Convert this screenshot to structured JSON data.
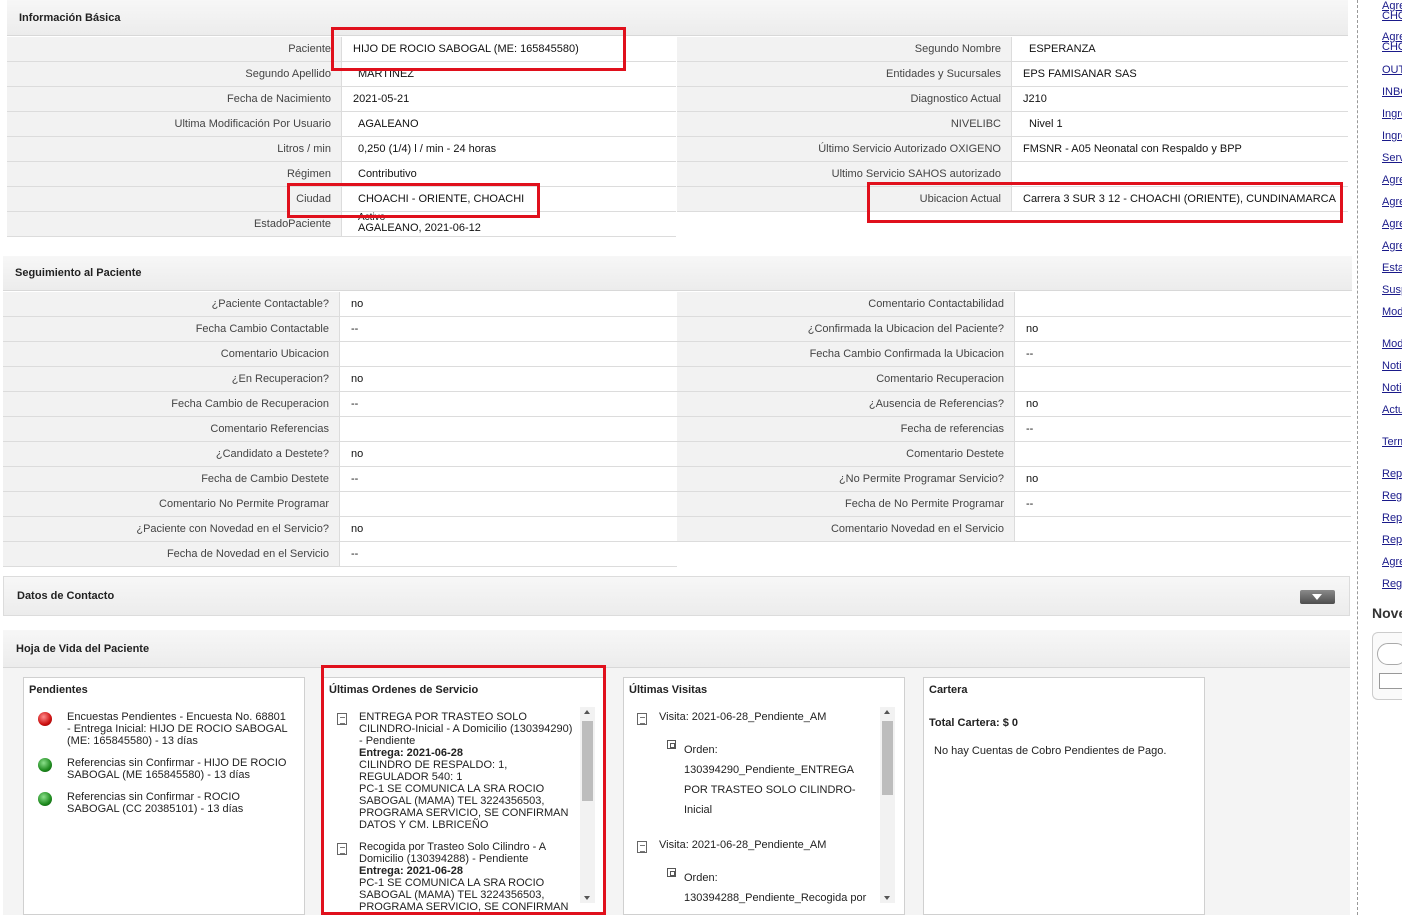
{
  "basic_info": {
    "title": "Información Básica",
    "left_rows": [
      {
        "label": "Paciente",
        "value": "HIJO DE ROCIO SABOGAL (ME: 165845580)"
      },
      {
        "label": "Segundo Apellido",
        "value": "MARTINEZ"
      },
      {
        "label": "Fecha de Nacimiento",
        "value": "2021-05-21"
      },
      {
        "label": "Ultima Modificación Por Usuario",
        "value": "AGALEANO"
      },
      {
        "label": "Litros / min",
        "value": "0,250 (1/4) l / min - 24 horas"
      },
      {
        "label": "Régimen",
        "value": "Contributivo"
      },
      {
        "label": "Ciudad",
        "value": "CHOACHI - ORIENTE, CHOACHI"
      },
      {
        "label": "EstadoPaciente",
        "value": "Activo",
        "value2": "AGALEANO, 2021-06-12"
      }
    ],
    "right_rows": [
      {
        "label": "Segundo Nombre",
        "value": "ESPERANZA"
      },
      {
        "label": "Entidades y Sucursales",
        "value": "EPS FAMISANAR SAS"
      },
      {
        "label": "Diagnostico Actual",
        "value": "J210"
      },
      {
        "label": "NIVELIBC",
        "value": "Nivel 1"
      },
      {
        "label": "Último Servicio Autorizado OXIGENO",
        "value": "FMSNR - A05 Neonatal con Respaldo y BPP"
      },
      {
        "label": "Ultimo Servicio SAHOS autorizado",
        "value": ""
      },
      {
        "label": "Ubicacion Actual",
        "value": "Carrera 3 SUR 3 12 - CHOACHI (ORIENTE), CUNDINAMARCA"
      }
    ]
  },
  "followup": {
    "title": "Seguimiento al Paciente",
    "left_rows": [
      {
        "label": "¿Paciente Contactable?",
        "value": "no"
      },
      {
        "label": "Fecha Cambio Contactable",
        "value": "--"
      },
      {
        "label": "Comentario Ubicacion",
        "value": ""
      },
      {
        "label": "¿En Recuperacion?",
        "value": "no"
      },
      {
        "label": "Fecha Cambio de Recuperacion",
        "value": "--"
      },
      {
        "label": "Comentario Referencias",
        "value": ""
      },
      {
        "label": "¿Candidato a Destete?",
        "value": "no"
      },
      {
        "label": "Fecha de Cambio Destete",
        "value": "--"
      },
      {
        "label": "Comentario No Permite Programar",
        "value": ""
      },
      {
        "label": "¿Paciente con Novedad en el Servicio?",
        "value": "no"
      },
      {
        "label": "Fecha de Novedad en el Servicio",
        "value": "--"
      }
    ],
    "right_rows": [
      {
        "label": "Comentario Contactabilidad",
        "value": ""
      },
      {
        "label": "¿Confirmada la Ubicacion del Paciente?",
        "value": "no"
      },
      {
        "label": "Fecha Cambio Confirmada la Ubicacion",
        "value": "--"
      },
      {
        "label": "Comentario Recuperacion",
        "value": ""
      },
      {
        "label": "¿Ausencia de Referencias?",
        "value": "no"
      },
      {
        "label": "Fecha de referencias",
        "value": "--"
      },
      {
        "label": "Comentario Destete",
        "value": ""
      },
      {
        "label": "¿No Permite Programar Servicio?",
        "value": "no"
      },
      {
        "label": "Fecha de No Permite Programar",
        "value": "--"
      },
      {
        "label": "Comentario Novedad en el Servicio",
        "value": ""
      }
    ]
  },
  "contact": {
    "title": "Datos de Contacto"
  },
  "history": {
    "title": "Hoja de Vida del Paciente",
    "pending": {
      "title": "Pendientes",
      "items": [
        {
          "status": "red",
          "text": [
            "Encuestas Pendientes - Encuesta No. 68801",
            "- Entrega Inicial: HIJO DE ROCIO SABOGAL",
            "(ME: 165845580) - 13 días"
          ]
        },
        {
          "status": "green",
          "text": [
            "Referencias sin Confirmar - HIJO DE ROCIO",
            "SABOGAL (ME 165845580) - 13 días"
          ]
        },
        {
          "status": "green",
          "text": [
            "Referencias sin Confirmar - ROCIO",
            "SABOGAL (CC 20385101) - 13 días"
          ]
        }
      ]
    },
    "orders": {
      "title": "Últimas Ordenes de Servicio",
      "items": [
        {
          "lines": [
            "ENTREGA POR TRASTEO SOLO",
            "CILINDRO-Inicial - A Domicilio (130394290)",
            "- Pendiente"
          ],
          "bold": "Entrega: 2021-06-28",
          "rest": [
            "CILINDRO DE RESPALDO: 1,",
            "REGULADOR 540: 1",
            "PC-1 SE COMUNICA LA SRA ROCIO",
            "SABOGAL (MAMA) TEL 3224356503,",
            "PROGRAMA SERVICIO, SE CONFIRMAN",
            "DATOS Y CM. LBRICEÑO"
          ]
        },
        {
          "lines": [
            "Recogida por Trasteo Solo Cilindro - A",
            "Domicilio (130394288) - Pendiente"
          ],
          "bold": "Entrega: 2021-06-28",
          "rest": [
            "PC-1 SE COMUNICA LA SRA ROCIO",
            "SABOGAL (MAMA) TEL 3224356503,",
            "PROGRAMA SERVICIO, SE CONFIRMAN"
          ]
        }
      ]
    },
    "visits": {
      "title": "Últimas Visitas",
      "items": [
        {
          "visit": "Visita: 2021-06-28_Pendiente_AM",
          "order_label": "Orden:",
          "order_lines": [
            "130394290_Pendiente_ENTREGA",
            "POR TRASTEO SOLO CILINDRO-",
            "Inicial"
          ]
        },
        {
          "visit": "Visita: 2021-06-28_Pendiente_AM",
          "order_label": "Orden:",
          "order_lines": [
            "130394288_Pendiente_Recogida por"
          ]
        }
      ]
    },
    "portfolio": {
      "title": "Cartera",
      "total": "Total Cartera: $ 0",
      "message": "No hay Cuentas de Cobro Pendientes de Pago."
    }
  },
  "sidebar": {
    "links": [
      "Agre",
      "CHO",
      "Agre",
      "CHO",
      "OUT",
      "INBO",
      "Ingre",
      "Ingre",
      "Serv",
      "Agre",
      "Agre",
      "Agre",
      "Agre",
      "Esta",
      "Susp",
      "Modi",
      "Modi",
      "Noti",
      "Noti",
      "Actu",
      "Term",
      "Rep",
      "Regi",
      "Rep",
      "Rep",
      "Agre",
      "Regi"
    ],
    "section_title": "Nove"
  }
}
